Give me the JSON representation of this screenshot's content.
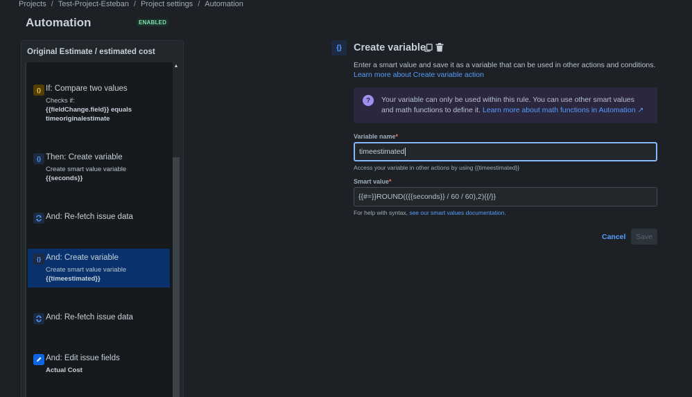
{
  "breadcrumb": [
    "Projects",
    "Test-Project-Esteban",
    "Project settings",
    "Automation"
  ],
  "header": {
    "title": "Automation",
    "status_badge": "ENABLED"
  },
  "rule": {
    "name": "Original Estimate / estimated cost",
    "items": [
      {
        "icon": "{}",
        "kind": "condition",
        "title": "If: Compare two values",
        "sub": "Checks if:",
        "bold": "{{fieldChange.field}} equals timeoriginalestimate"
      },
      {
        "icon": "{}",
        "kind": "action",
        "title": "Then: Create variable",
        "sub": "Create smart value variable",
        "bold": "{{seconds}}"
      },
      {
        "icon": "refresh",
        "kind": "action",
        "title": "And: Re-fetch issue data"
      },
      {
        "icon": "{}",
        "kind": "action",
        "title": "And: Create variable",
        "sub": "Create smart value variable",
        "bold": "{{timeestimated}}",
        "selected": true
      },
      {
        "icon": "refresh",
        "kind": "action",
        "title": "And: Re-fetch issue data"
      },
      {
        "icon": "pencil",
        "kind": "action",
        "title": "And: Edit issue fields",
        "bold": "Actual Cost"
      }
    ]
  },
  "detail": {
    "icon": "{}",
    "title": "Create variable",
    "description": "Enter a smart value and save it as a variable that can be used in other actions and conditions.",
    "description_link": "Learn more about Create variable action",
    "info_text": "Your variable can only be used within this rule. You can use other smart values and math functions to define it.",
    "info_link": "Learn more about math functions in Automation ↗",
    "variable_name_label": "Variable name",
    "variable_name_value": "timeestimated",
    "variable_name_hint": "Access your variable in other actions by using {{timeestimated}}",
    "smart_value_label": "Smart value",
    "smart_value_value": "{{#=}}ROUND(({{seconds}} / 60 / 60),2){{/}}",
    "help_text": "For help with syntax,",
    "help_link": "see our smart values documentation",
    "help_end": ".",
    "required_mark": "*",
    "cancel_label": "Cancel",
    "save_label": "Save"
  },
  "colors": {
    "accent": "#579dff",
    "background": "#1d2125",
    "selected": "#09326c",
    "badge": "#7ee2b8"
  }
}
